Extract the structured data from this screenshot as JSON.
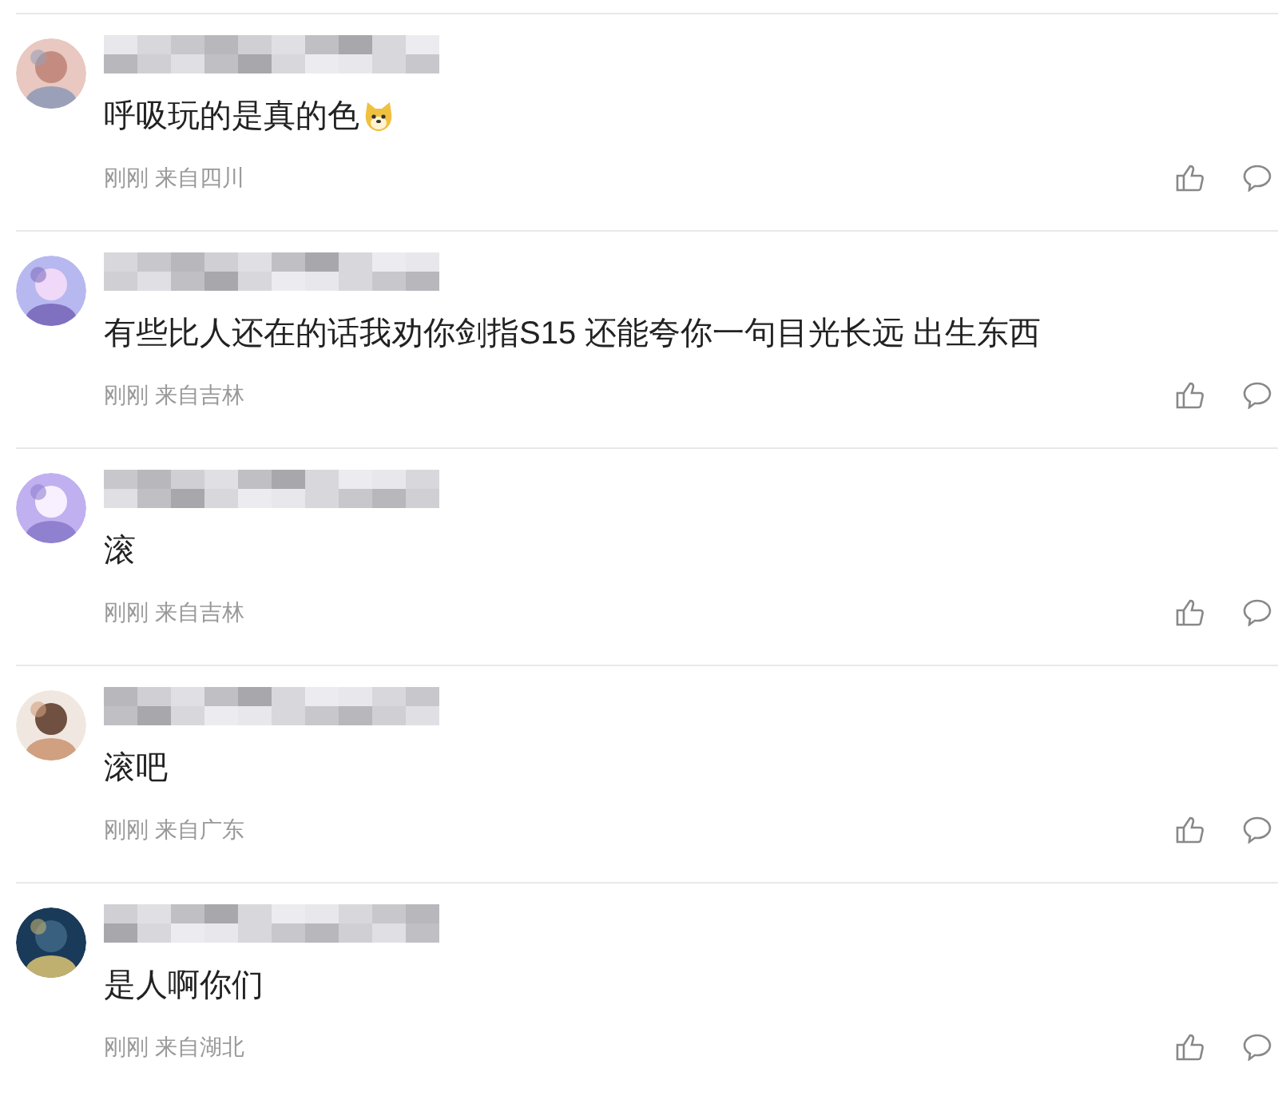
{
  "comments": [
    {
      "text": "呼吸玩的是真的色",
      "emoji": true,
      "meta": "刚刚 来自四川"
    },
    {
      "text": "有些比人还在的话我劝你剑指S15 还能夸你一句目光长远 出生东西",
      "emoji": false,
      "meta": "刚刚 来自吉林"
    },
    {
      "text": "滚",
      "emoji": false,
      "meta": "刚刚 来自吉林"
    },
    {
      "text": "滚吧",
      "emoji": false,
      "meta": "刚刚 来自广东"
    },
    {
      "text": "是人啊你们",
      "emoji": false,
      "meta": "刚刚 来自湖北"
    }
  ]
}
